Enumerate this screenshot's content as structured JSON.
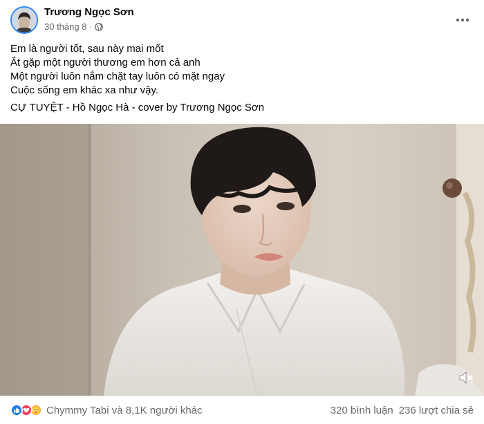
{
  "post": {
    "author": "Trương Ngọc Sơn",
    "date": "30 tháng 8",
    "dot": "·",
    "caption_lines": [
      "Em là người tốt, sau này mai mốt",
      "Ắt gặp một người thương em hơn cả anh",
      "Một người luôn nắm chặt tay luôn có mặt ngay",
      "Cuộc sống em khác xa như vậy."
    ],
    "song_credit": "CỰ TUYỆT - Hồ Ngọc Hà - cover by Trương Ngọc Sơn"
  },
  "footer": {
    "reactions_text": "Chymmy Tabi và 8,1K người khác",
    "comments": "320 bình luận",
    "shares": "236 lượt chia sẻ"
  },
  "icons": {
    "more": "more-options-icon",
    "privacy": "globe-icon",
    "mute": "volume-mute-icon",
    "reactions": [
      "like-icon",
      "love-icon",
      "care-icon"
    ]
  },
  "colors": {
    "accent": "#1877f2",
    "love": "#f33e58",
    "care": "#f7b125",
    "secondary_text": "#65676b"
  }
}
